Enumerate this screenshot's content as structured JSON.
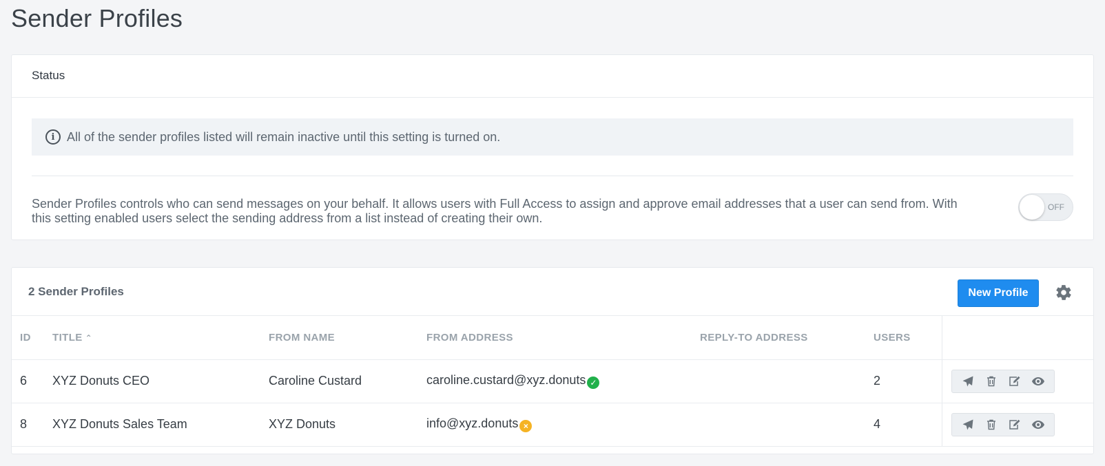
{
  "page": {
    "title": "Sender Profiles"
  },
  "status_card": {
    "header": "Status",
    "notice": "All of the sender profiles listed will remain inactive until this setting is turned on.",
    "description": "Sender Profiles controls who can send messages on your behalf. It allows users with Full Access to assign and approve email addresses that a user can send from. With this setting enabled users select the sending address from a list instead of creating their own.",
    "toggle": {
      "label": "OFF",
      "state": "off"
    }
  },
  "profiles_card": {
    "count_label": "2 Sender Profiles",
    "new_button": "New Profile",
    "columns": {
      "id": "ID",
      "title": "TITLE",
      "from_name": "FROM NAME",
      "from_address": "FROM ADDRESS",
      "reply_to": "REPLY-TO ADDRESS",
      "users": "USERS"
    },
    "sort": {
      "column": "title",
      "direction": "ascending"
    },
    "rows": [
      {
        "id": "6",
        "title": "XYZ Donuts CEO",
        "from_name": "Caroline Custard",
        "from_address": "caroline.custard@xyz.donuts",
        "address_status": "verified",
        "reply_to": "",
        "users": "2"
      },
      {
        "id": "8",
        "title": "XYZ Donuts Sales Team",
        "from_name": "XYZ Donuts",
        "from_address": "info@xyz.donuts",
        "address_status": "unverified",
        "reply_to": "",
        "users": "4"
      }
    ],
    "row_actions": [
      "send-icon",
      "trash-icon",
      "edit-icon",
      "eye-icon"
    ]
  },
  "colors": {
    "primary": "#1f8cef",
    "verified": "#21b04b",
    "unverified": "#f5b324",
    "icon": "#6b747c"
  }
}
